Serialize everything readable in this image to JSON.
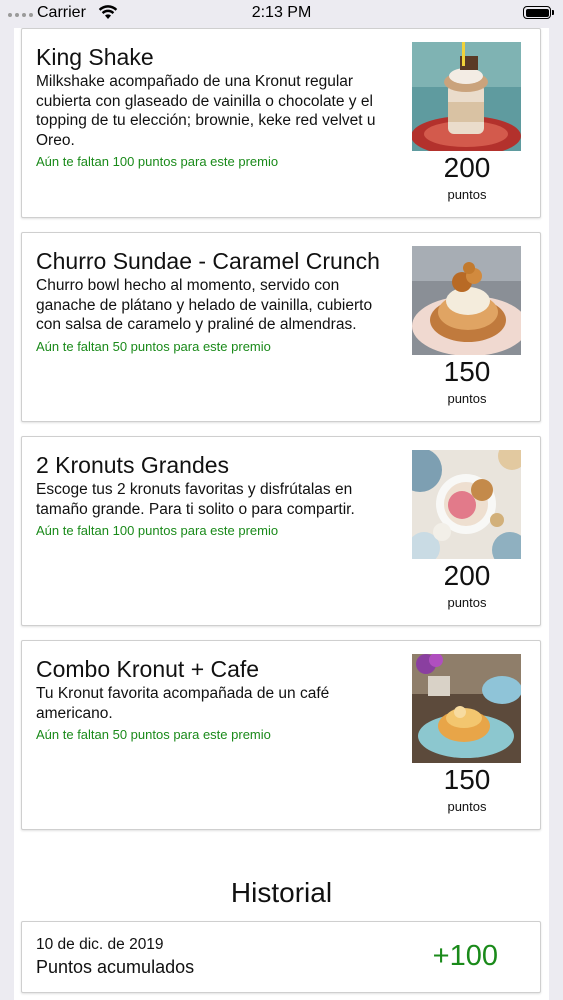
{
  "status_bar": {
    "carrier": "Carrier",
    "time": "2:13 PM"
  },
  "rewards": [
    {
      "title": "King Shake",
      "description": "Milkshake acompañado de una Kronut regular cubierta con glaseado de vainilla o chocolate y el topping de tu elección; brownie, keke red velvet u Oreo.",
      "needed": "Aún te faltan 100 puntos para este premio",
      "points": "200",
      "points_label": "puntos",
      "image": "milkshake-photo"
    },
    {
      "title": "Churro Sundae - Caramel Crunch",
      "description": "Churro bowl hecho al momento, servido con ganache de plátano y helado de vainilla, cubierto con salsa de caramelo y praliné de almendras.",
      "needed": "Aún te faltan 50 puntos para este premio",
      "points": "150",
      "points_label": "puntos",
      "image": "churro-sundae-photo"
    },
    {
      "title": "2 Kronuts Grandes",
      "description": "Escoge tus 2 kronuts favoritas y disfrútalas en tamaño grande. Para ti solito o para compartir.",
      "needed": "Aún te faltan 100 puntos para este premio",
      "points": "200",
      "points_label": "puntos",
      "image": "kronuts-table-photo"
    },
    {
      "title": "Combo Kronut + Cafe",
      "description": "Tu Kronut favorita acompañada de un café americano.",
      "needed": "Aún te faltan 50 puntos para este premio",
      "points": "150",
      "points_label": "puntos",
      "image": "kronut-coffee-photo"
    }
  ],
  "history": {
    "title": "Historial",
    "entries": [
      {
        "date": "10 de dic. de 2019",
        "description": "Puntos acumulados",
        "points": "+100"
      }
    ]
  },
  "colors": {
    "accent_green": "#1a8a1a",
    "background": "#ecebf1",
    "card_border": "#cfcfcf"
  }
}
